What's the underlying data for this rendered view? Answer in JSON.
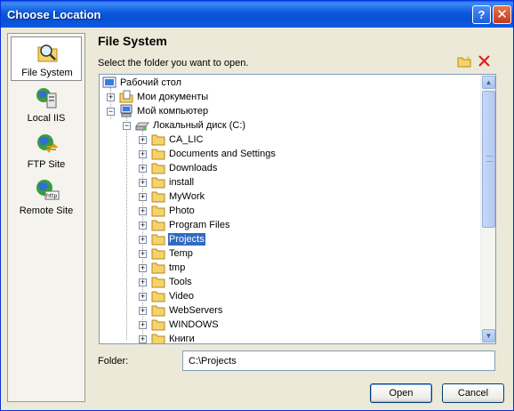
{
  "window": {
    "title": "Choose Location"
  },
  "places": [
    {
      "label": "File System",
      "icon": "folder-search-icon",
      "selected": true
    },
    {
      "label": "Local IIS",
      "icon": "iis-server-icon",
      "selected": false
    },
    {
      "label": "FTP Site",
      "icon": "ftp-globe-icon",
      "selected": false
    },
    {
      "label": "Remote Site",
      "icon": "http-globe-icon",
      "selected": false
    }
  ],
  "main": {
    "heading": "File System",
    "subtitle": "Select the folder you want to open."
  },
  "tree": {
    "desktop": "Рабочий стол",
    "my_documents": "Мои документы",
    "my_computer": "Мой компьютер",
    "local_disk": "Локальный диск (C:)",
    "folders": [
      "CA_LIC",
      "Documents and Settings",
      "Downloads",
      "install",
      "MyWork",
      "Photo",
      "Program Files",
      "Projects",
      "Temp",
      "tmp",
      "Tools",
      "Video",
      "WebServers",
      "WINDOWS",
      "Книги"
    ],
    "selected_folder": "Projects"
  },
  "folder_field": {
    "label": "Folder:",
    "value": "C:\\Projects"
  },
  "buttons": {
    "open": "Open",
    "cancel": "Cancel"
  },
  "colors": {
    "selection": "#316ac5",
    "titlebar": "#0b57df",
    "folder": "#f6d36a"
  }
}
